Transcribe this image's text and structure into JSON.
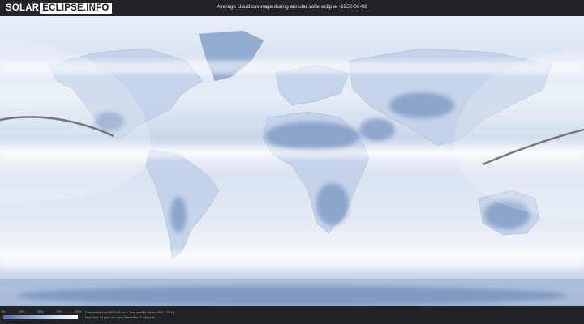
{
  "header": {
    "logo_left": "SOLAR",
    "logo_right": "ECLIPSE.INFO",
    "title": "Average cloud coverage during annular solar eclipse -1952-06-02"
  },
  "legend": {
    "ticks": [
      "0%",
      "25%",
      "50%",
      "75%",
      "100%"
    ]
  },
  "credits": {
    "line1": "Data provided by NASA's Aqua & Terra satellite (Years: 2000 - 2019)",
    "line2": "https://neo.sci.gsfc.nasa.gov | Resolution: 0.1 degrees"
  },
  "colors": {
    "header_bg": "#222327",
    "clear_sky": "#4d6fa8",
    "cloudy": "#ffffff",
    "eclipse_path": "#666a70"
  }
}
